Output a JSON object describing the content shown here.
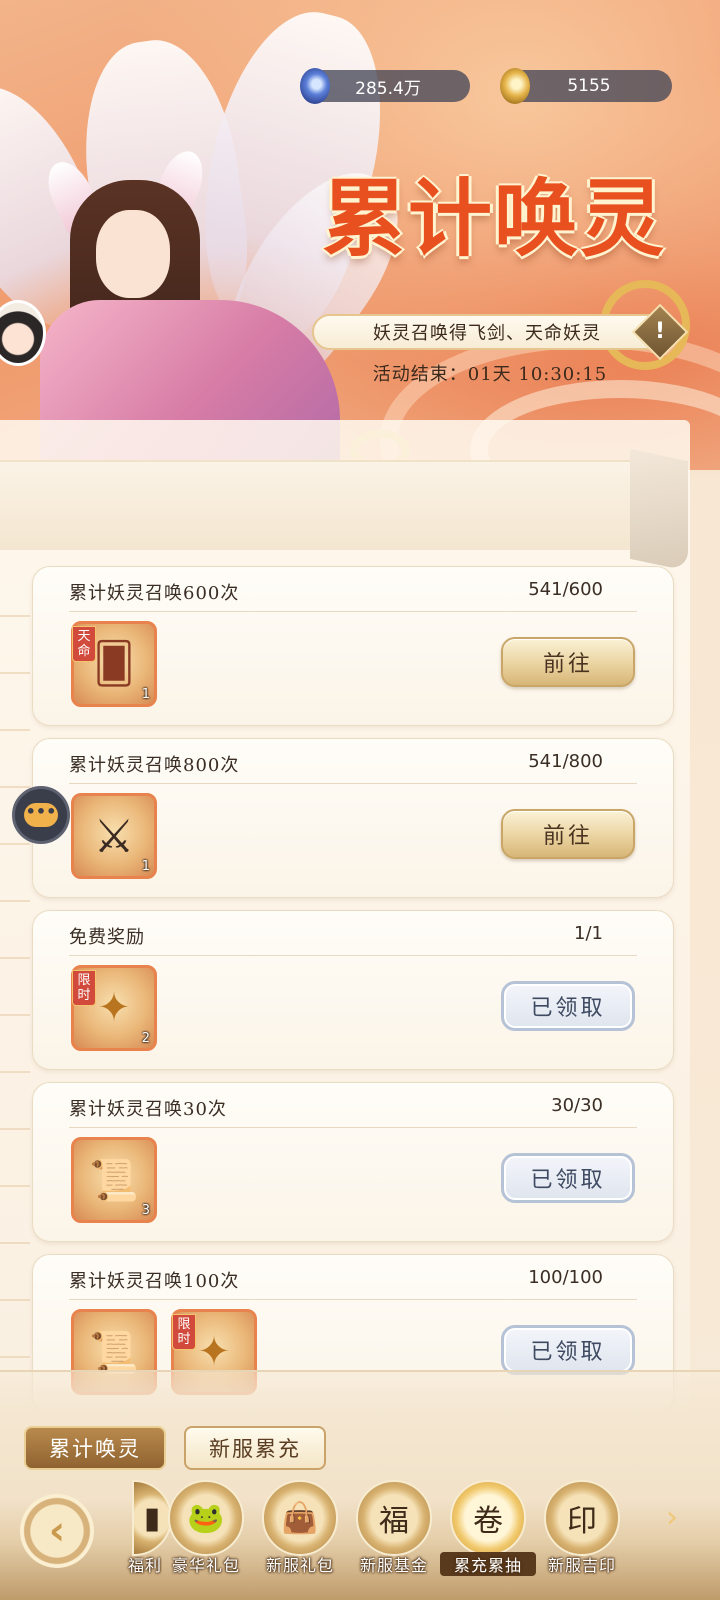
{
  "currency": {
    "gems": "285.4万",
    "coins": "5155"
  },
  "event": {
    "title": "累计唤灵",
    "subtitle": "妖灵召唤得飞剑、天命妖灵",
    "info_icon": "!",
    "end_label": "活动结束：",
    "end_time": "01天 10:30:15"
  },
  "tasks": [
    {
      "title": "累计妖灵召唤600次",
      "progress": "541/600",
      "rewards": [
        {
          "icon": "summon-card-icon",
          "tag": "天命",
          "count": "1"
        }
      ],
      "button": "前往",
      "state": "go"
    },
    {
      "title": "累计妖灵召唤800次",
      "progress": "541/800",
      "rewards": [
        {
          "icon": "flying-swords-icon",
          "tag": "",
          "count": "1"
        }
      ],
      "button": "前往",
      "state": "go"
    },
    {
      "title": "免费奖励",
      "progress": "1/1",
      "rewards": [
        {
          "icon": "sword-token-icon",
          "tag": "限时",
          "count": "2"
        }
      ],
      "button": "已领取",
      "state": "claimed"
    },
    {
      "title": "累计妖灵召唤30次",
      "progress": "30/30",
      "rewards": [
        {
          "icon": "scroll-icon",
          "tag": "",
          "count": "3"
        }
      ],
      "button": "已领取",
      "state": "claimed"
    },
    {
      "title": "累计妖灵召唤100次",
      "progress": "100/100",
      "rewards": [
        {
          "icon": "scroll-icon",
          "tag": "",
          "count": ""
        },
        {
          "icon": "sword-token-icon",
          "tag": "限时",
          "count": ""
        }
      ],
      "button": "已领取",
      "state": "claimed"
    }
  ],
  "chat_icon": "•••",
  "tabs": {
    "active": "累计唤灵",
    "inactive": "新服累充"
  },
  "nav": {
    "back_icon": "‹",
    "next_icon": "›",
    "items": [
      {
        "label": "福利",
        "icon": "gift-icon"
      },
      {
        "label": "豪华礼包",
        "icon": "luxury-pack-icon"
      },
      {
        "label": "新服礼包",
        "icon": "new-server-pack-icon"
      },
      {
        "label": "新服基金",
        "icon": "fund-icon"
      },
      {
        "label": "累充累抽",
        "icon": "recharge-draw-icon",
        "active": true
      },
      {
        "label": "新服吉印",
        "icon": "seal-icon"
      }
    ]
  },
  "colors": {
    "title": "#e8511f",
    "accent_gold": "#d7b677",
    "claimed_border": "#b6c2d6"
  }
}
